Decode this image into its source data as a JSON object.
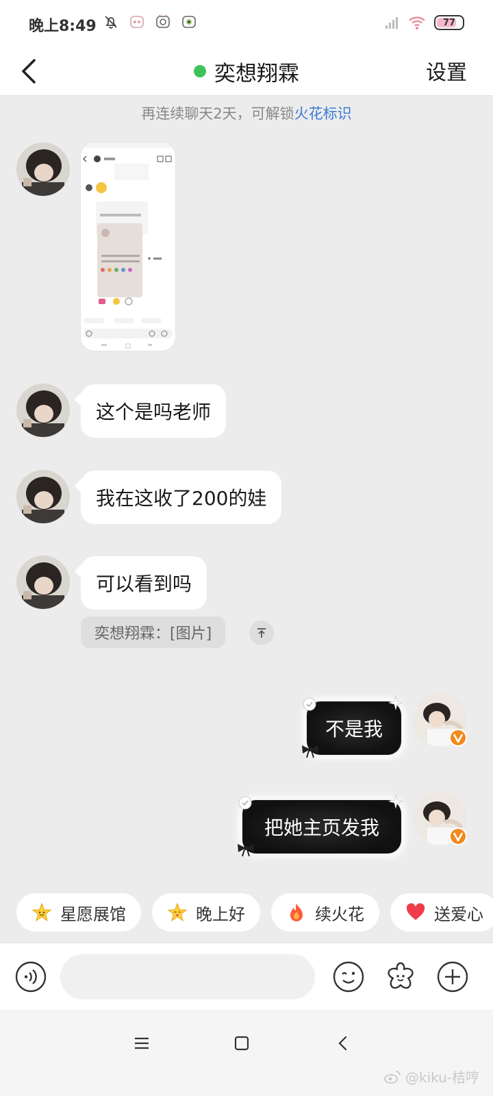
{
  "status_bar": {
    "time": "晚上8:49",
    "battery_level": "77",
    "battery_fraction": 0.77,
    "icons": [
      "bell-off-icon",
      "app-icon-1",
      "app-icon-2",
      "app-icon-3",
      "signal-icon",
      "wifi-icon",
      "battery-icon"
    ]
  },
  "header": {
    "back_icon": "chevron-left-icon",
    "title": "奕想翔霖",
    "online": true,
    "settings_label": "设置"
  },
  "notice": {
    "text": "再连续聊天2天，可解锁",
    "link": "火花标识"
  },
  "messages": [
    {
      "side": "in",
      "type": "image",
      "alt": "screenshot"
    },
    {
      "side": "in",
      "type": "text",
      "text": "这个是吗老师"
    },
    {
      "side": "in",
      "type": "text",
      "text": "我在这收了200的娃"
    },
    {
      "side": "in",
      "type": "text",
      "text": "可以看到吗"
    },
    {
      "side": "out",
      "type": "text",
      "text": "不是我"
    },
    {
      "side": "out",
      "type": "text",
      "text": "把她主页发我"
    }
  ],
  "quote": {
    "text": "奕想翔霖：[图片]",
    "button_icon": "scroll-to-top-icon"
  },
  "chips": [
    {
      "label": "星愿展馆",
      "icon": "star-face-icon"
    },
    {
      "label": "晚上好",
      "icon": "star-face-icon"
    },
    {
      "label": "续火花",
      "icon": "fire-icon"
    },
    {
      "label": "送爱心",
      "icon": "heart-icon"
    }
  ],
  "input_bar": {
    "placeholder": "",
    "icons": [
      "voice-icon",
      "emoji-icon",
      "flower-icon",
      "plus-icon"
    ]
  },
  "nav_bar": {
    "icons": [
      "menu-icon",
      "home-icon",
      "back-icon"
    ]
  },
  "watermark": "@kiku-桔哼",
  "colors": {
    "online": "#3dc35b",
    "link": "#3a7bd5",
    "background": "#ececec",
    "bubble_in": "#ffffff",
    "bubble_out": "#111111"
  }
}
